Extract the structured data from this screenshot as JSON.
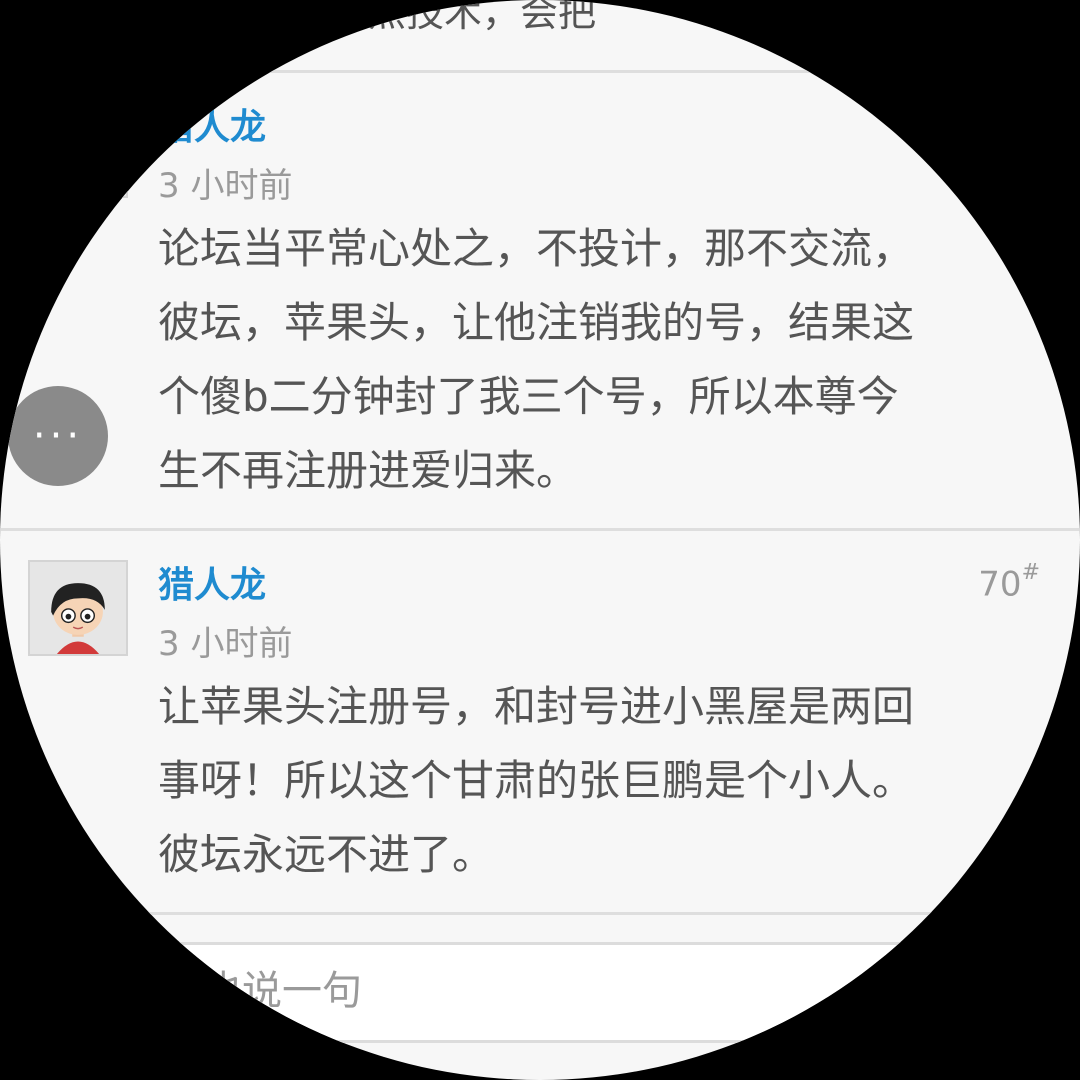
{
  "top_partial_text": "装点技术，会把",
  "posts": [
    {
      "author": "猎人龙",
      "time": "3 小时前",
      "content": "论坛当平常心处之，不投计，那不交流，\n彼坛，苹果头，让他注销我的号，结果这\n个傻b二分钟封了我三个号，所以本尊今\n生不再注册进爱归来。"
    },
    {
      "author": "猎人龙",
      "time": "3 小时前",
      "floor": "70",
      "floor_mark": "#",
      "content": "让苹果头注册号，和封号进小黑屋是两回\n事呀！所以这个甘肃的张巨鹏是个小人。\n彼坛永远不进了。"
    }
  ],
  "more_button_label": "···",
  "reply": {
    "placeholder": "我也说一句"
  },
  "colors": {
    "author": "#1f8bd0",
    "text": "#555555",
    "meta": "#9a9a9a",
    "background": "#f7f7f7"
  },
  "icons": {
    "more": "more-dots-icon",
    "avatar": "cartoon-boy-avatar"
  }
}
